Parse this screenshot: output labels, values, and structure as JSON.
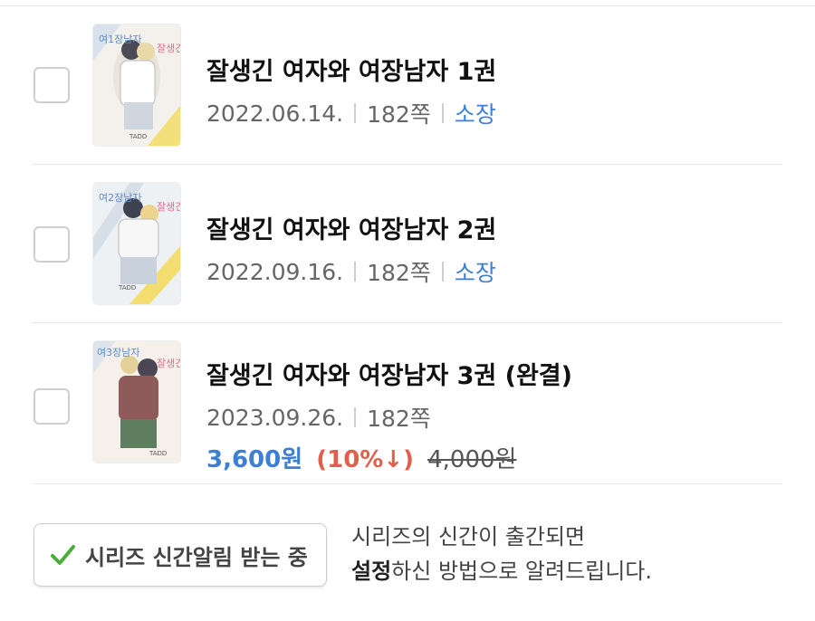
{
  "books": [
    {
      "title": "잘생긴 여자와 여장남자 1권",
      "date": "2022.06.14.",
      "pages": "182쪽",
      "status": "소장",
      "cover_text": {
        "left": "여1장남자",
        "right": "잘생긴여자",
        "author": "TADD"
      }
    },
    {
      "title": "잘생긴 여자와 여장남자 2권",
      "date": "2022.09.16.",
      "pages": "182쪽",
      "status": "소장",
      "cover_text": {
        "left": "여2장남자",
        "right": "잘생긴여자",
        "author": "TADD"
      }
    },
    {
      "title": "잘생긴 여자와 여장남자 3권 (완결)",
      "date": "2023.09.26.",
      "pages": "182쪽",
      "price": "3,600원",
      "discount": "(10%↓)",
      "original_price": "4,000원",
      "cover_text": {
        "left": "여3장남자",
        "right": "잘생긴여자",
        "author": "TADD"
      }
    }
  ],
  "series_alert": {
    "button_label": "시리즈 신간알림 받는 중",
    "notice_line1": "시리즈의 신간이 출간되면",
    "notice_bold": "설정",
    "notice_rest": "하신 방법으로 알려드립니다."
  },
  "colors": {
    "accent_blue": "#3d7fd6",
    "discount_red": "#e0604b",
    "check_green": "#4cae3a"
  }
}
